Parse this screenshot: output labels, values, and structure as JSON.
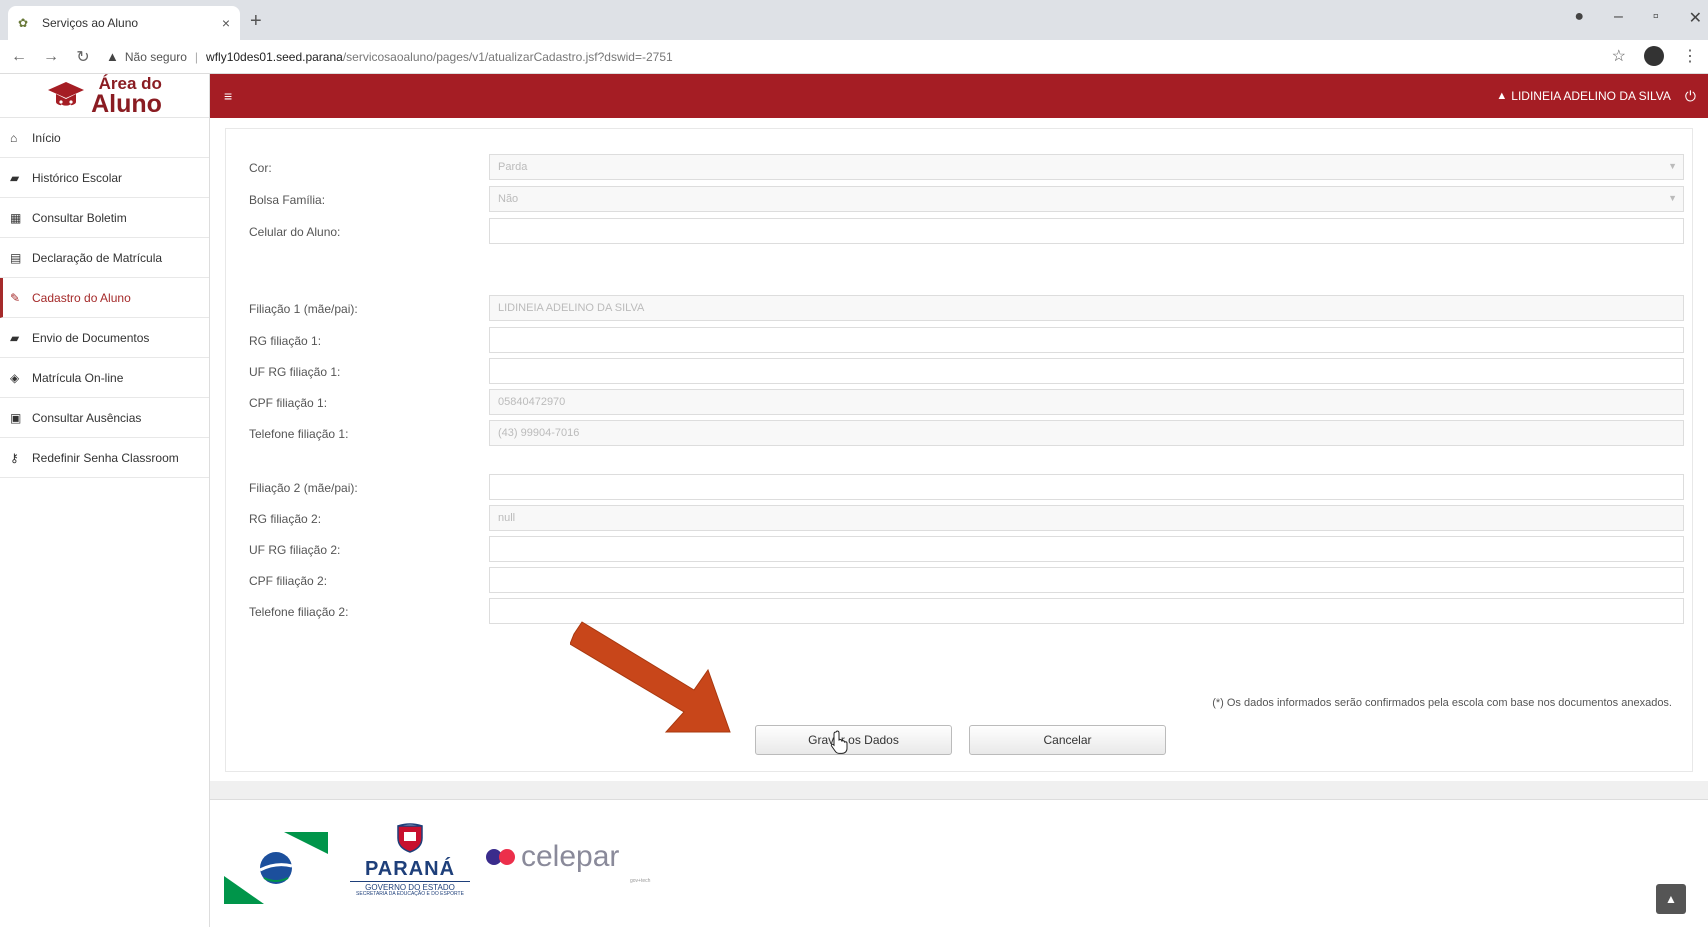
{
  "browser": {
    "tab_title": "Serviços ao Aluno",
    "tab_close": "×",
    "new_tab": "+",
    "warning_label": "Não seguro",
    "url_host": "wfly10des01.seed.parana",
    "url_path": "/servicosaoaluno/pages/v1/atualizarCadastro.jsf?dswid=-2751"
  },
  "sidebar": {
    "logo_small": "Área do",
    "logo_big": "Aluno",
    "items": [
      {
        "label": "Início",
        "icon": "home-icon",
        "glyph": "⌂"
      },
      {
        "label": "Histórico Escolar",
        "icon": "folder-icon",
        "glyph": "▰"
      },
      {
        "label": "Consultar Boletim",
        "icon": "grid-icon",
        "glyph": "▦"
      },
      {
        "label": "Declaração de Matrícula",
        "icon": "document-icon",
        "glyph": "▤"
      },
      {
        "label": "Cadastro do Aluno",
        "icon": "edit-icon",
        "glyph": "✎"
      },
      {
        "label": "Envio de Documentos",
        "icon": "folder-icon",
        "glyph": "▰"
      },
      {
        "label": "Matrícula On-line",
        "icon": "graduation-cap-icon",
        "glyph": "◈"
      },
      {
        "label": "Consultar Ausências",
        "icon": "calendar-icon",
        "glyph": "▣"
      },
      {
        "label": "Redefinir Senha Classroom",
        "icon": "key-icon",
        "glyph": "⚷"
      }
    ]
  },
  "topbar": {
    "user_name": "LIDINEIA ADELINO DA SILVA"
  },
  "form": {
    "fields": [
      {
        "label": "Cor:",
        "value": "Parda",
        "kind": "select"
      },
      {
        "label": "Bolsa Família:",
        "value": "Não",
        "kind": "select"
      },
      {
        "label": "Celular do Aluno:",
        "value": "",
        "kind": "input"
      },
      {
        "label": "Filiação 1 (mãe/pai):",
        "value": "LIDINEIA ADELINO DA SILVA",
        "kind": "input"
      },
      {
        "label": "RG filiação 1:",
        "value": "",
        "kind": "input"
      },
      {
        "label": "UF RG filiação 1:",
        "value": "",
        "kind": "input"
      },
      {
        "label": "CPF filiação 1:",
        "value": "05840472970",
        "kind": "input"
      },
      {
        "label": "Telefone filiação 1:",
        "value": "(43) 99904-7016",
        "kind": "input"
      },
      {
        "label": "Filiação 2 (mãe/pai):",
        "value": "",
        "kind": "input"
      },
      {
        "label": "RG filiação 2:",
        "value": "null",
        "kind": "input"
      },
      {
        "label": "UF RG filiação 2:",
        "value": "",
        "kind": "input"
      },
      {
        "label": "CPF filiação 2:",
        "value": "",
        "kind": "input"
      },
      {
        "label": "Telefone filiação 2:",
        "value": "",
        "kind": "input"
      }
    ],
    "note": "(*) Os dados informados serão confirmados pela escola com base nos documentos anexados.",
    "save_label": "Gravar os Dados",
    "cancel_label": "Cancelar"
  },
  "footer": {
    "parana": "PARANÁ",
    "parana_sub": "GOVERNO DO ESTADO",
    "parana_sub2": "SECRETARIA DA EDUCAÇÃO E DO ESPORTE",
    "celepar": "celepar",
    "celepar_tag": "gov+tech"
  },
  "colors": {
    "brand": "#a51d24",
    "arrow": "#c8461a"
  }
}
